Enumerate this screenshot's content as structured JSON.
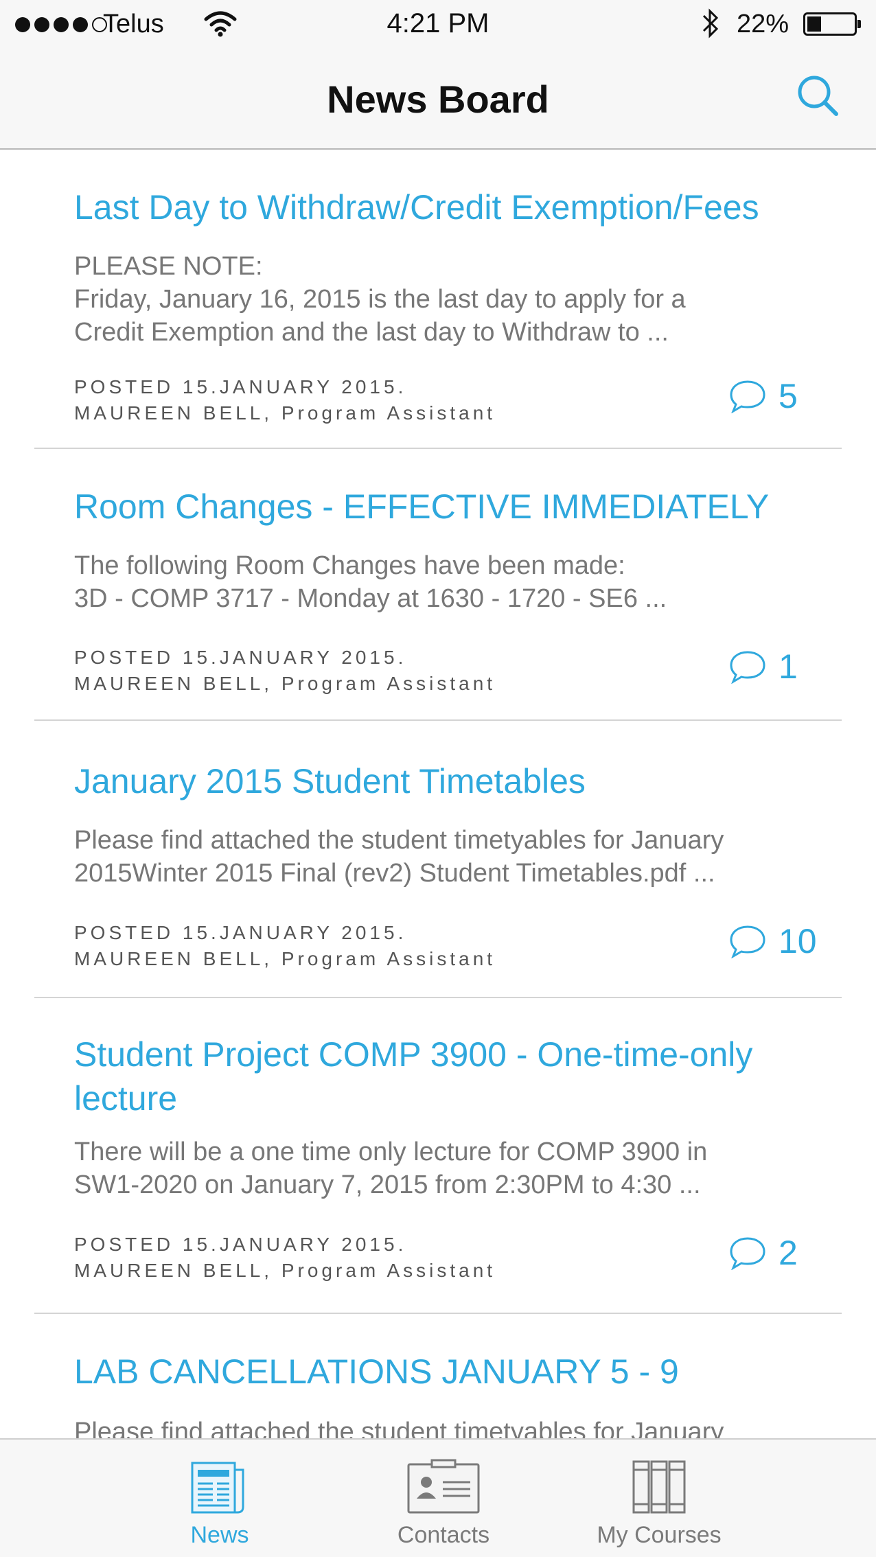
{
  "status_bar": {
    "carrier": "Telus",
    "time": "4:21 PM",
    "battery": "22%",
    "battery_level": 0.22
  },
  "header": {
    "title": "News Board"
  },
  "news": [
    {
      "title": "Last Day to Withdraw/Credit Exemption/Fees",
      "body_lines": [
        "PLEASE NOTE:",
        "Friday, January 16, 2015 is the last day to apply for a",
        "Credit Exemption and the last day to Withdraw to ..."
      ],
      "posted": "POSTED 15.JANUARY 2015.",
      "author": "MAUREEN BELL, Program Assistant",
      "comments": "5"
    },
    {
      "title": "Room Changes - EFFECTIVE IMMEDIATELY",
      "body_lines": [
        "The following Room Changes have been made:",
        "3D - COMP 3717 - Monday at 1630 - 1720 - SE6  ..."
      ],
      "posted": "POSTED 15.JANUARY 2015.",
      "author": "MAUREEN BELL, Program Assistant",
      "comments": "1"
    },
    {
      "title": "January 2015 Student Timetables",
      "body_lines": [
        "Please find attached the student timetyables for January",
        "2015Winter 2015 Final (rev2) Student Timetables.pdf ..."
      ],
      "posted": "POSTED 15.JANUARY 2015.",
      "author": "MAUREEN BELL, Program Assistant",
      "comments": "10"
    },
    {
      "title_lines": [
        "Student Project COMP 3900 - One-time-only",
        "lecture"
      ],
      "body_lines": [
        "There will be a one time only lecture for COMP 3900 in",
        "SW1-2020 on January 7, 2015 from 2:30PM to 4:30 ..."
      ],
      "posted": "POSTED 15.JANUARY 2015.",
      "author": "MAUREEN BELL, Program Assistant",
      "comments": "2"
    },
    {
      "title": "LAB CANCELLATIONS JANUARY 5 - 9",
      "body_lines": [
        "Please find attached the student timetyables for January"
      ]
    }
  ],
  "tabs": [
    {
      "label": "News",
      "icon": "newspaper-icon",
      "active": true
    },
    {
      "label": "Contacts",
      "icon": "contact-card-icon",
      "active": false
    },
    {
      "label": "My Courses",
      "icon": "books-icon",
      "active": false
    }
  ],
  "colors": {
    "accent": "#2fa8dd",
    "body_text": "#777777",
    "meta_text": "#555555"
  }
}
